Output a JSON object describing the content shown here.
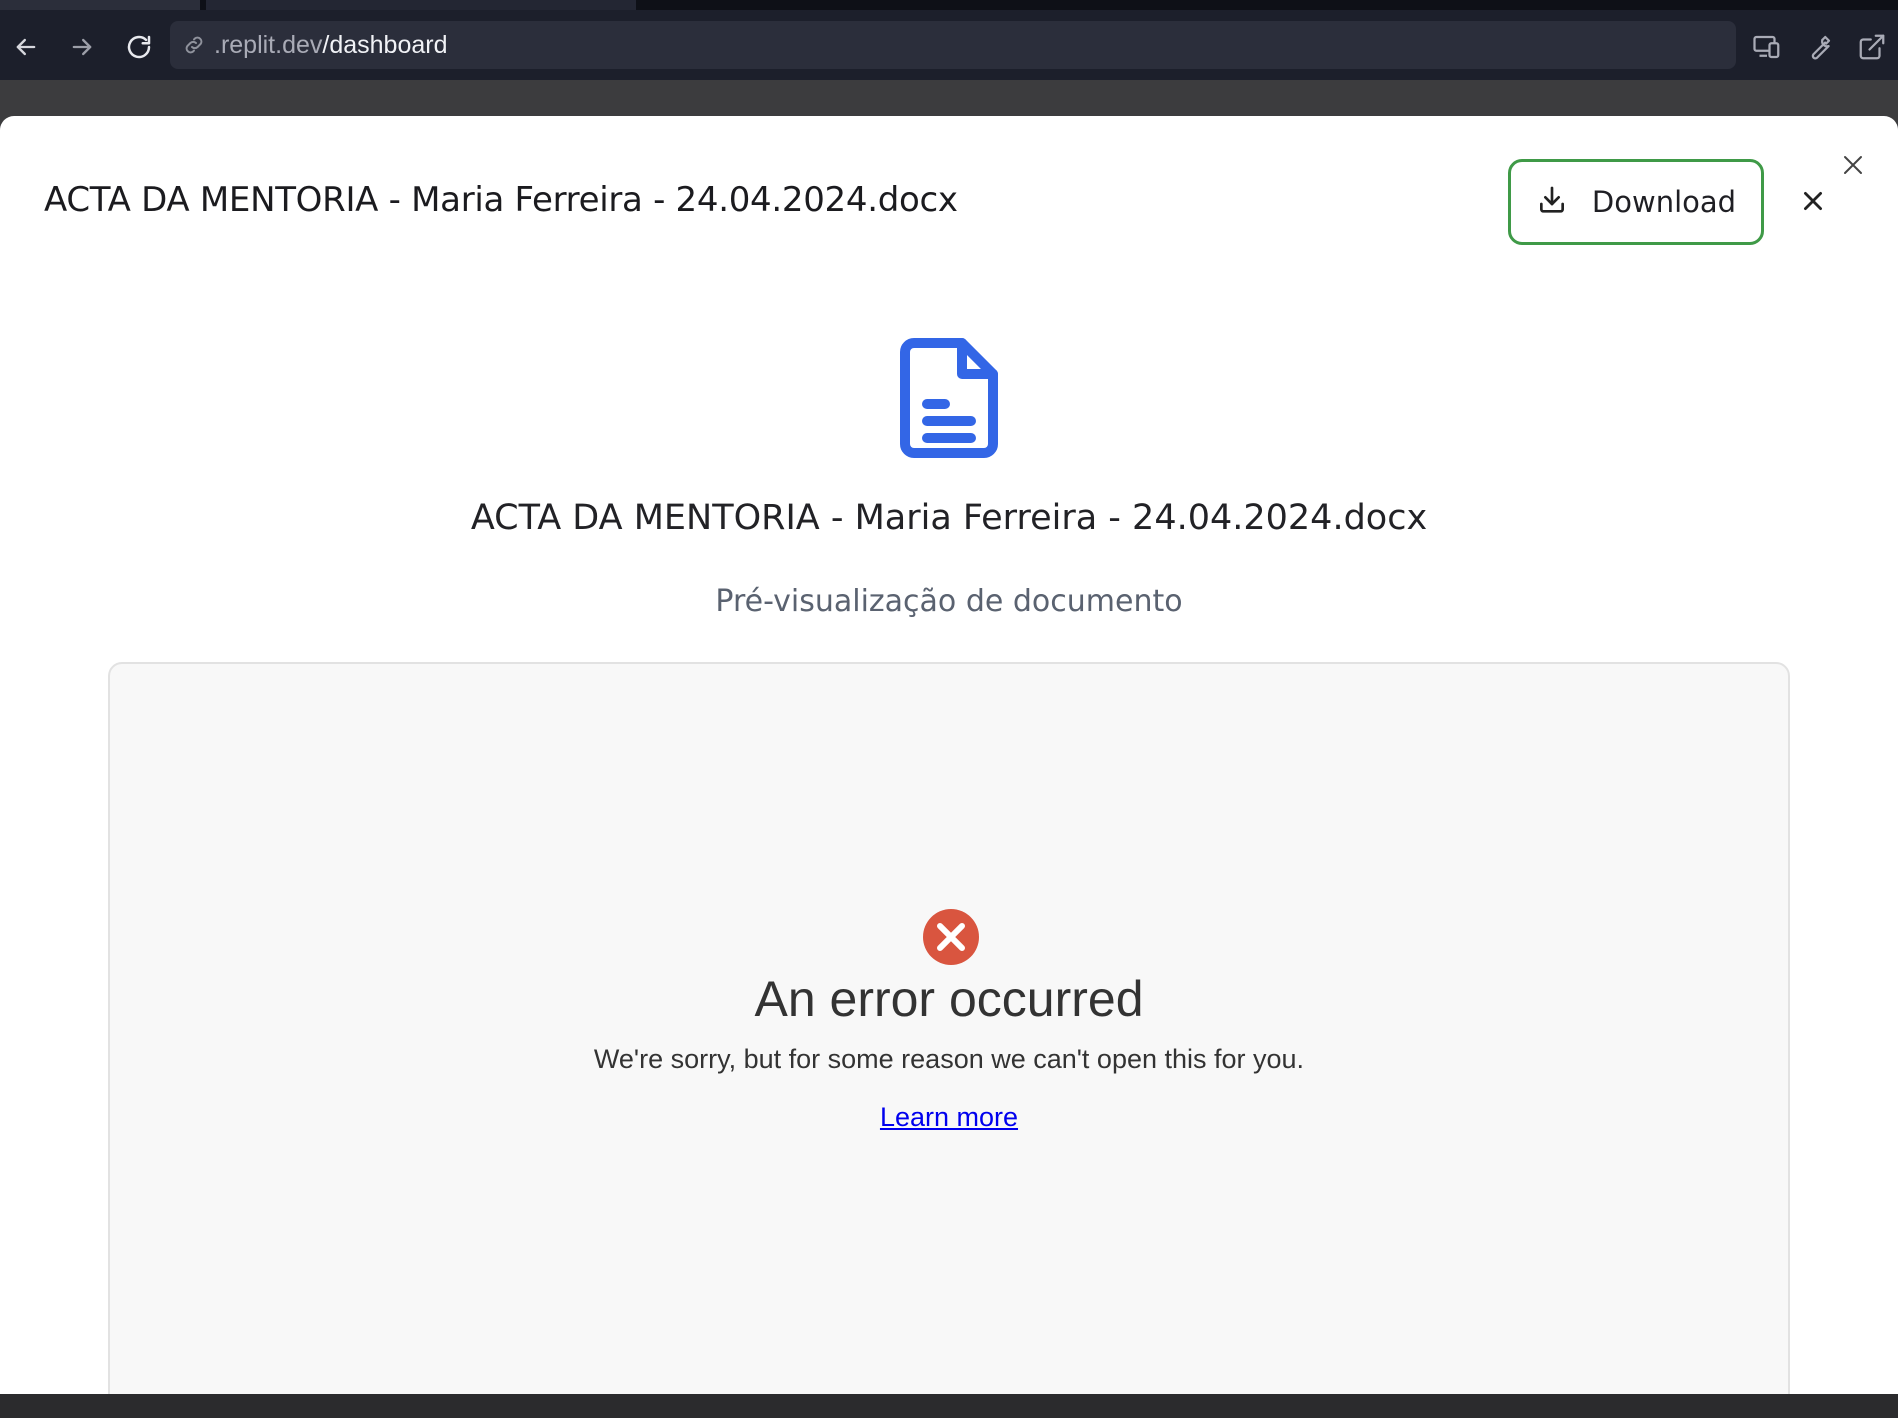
{
  "browser": {
    "url_host": ".replit.dev",
    "url_path": "/dashboard",
    "icons": [
      "back-icon",
      "forward-icon",
      "reload-icon",
      "link-icon",
      "devices-icon",
      "wrench-icon",
      "external-link-icon"
    ]
  },
  "modal": {
    "title": "ACTA DA MENTORIA - Maria Ferreira - 24.04.2024.docx",
    "download_label": "Download",
    "document": {
      "name": "ACTA DA MENTORIA - Maria Ferreira - 24.04.2024.docx",
      "subtitle": "Pré-visualização de documento",
      "icon": "file-text-icon"
    },
    "error": {
      "title": "An error occurred",
      "message": "We're sorry, but for some reason we can't open this for you.",
      "link": "Learn more"
    }
  },
  "colors": {
    "accent_green": "#3f9a47",
    "doc_icon_blue": "#3366e6",
    "error_red": "#d9553f",
    "link_blue": "#0000ee"
  }
}
